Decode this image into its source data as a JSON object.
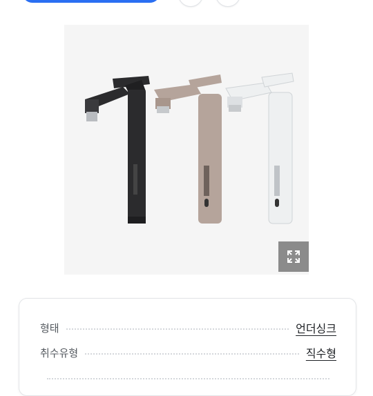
{
  "product": {
    "image_alt": "",
    "colors": [
      "#2b2b2d",
      "#b5a49b",
      "#eef0f1"
    ]
  },
  "zoom": {
    "icon": "expand-icon"
  },
  "specs": [
    {
      "label": "형태",
      "value": "언더싱크"
    },
    {
      "label": "취수유형",
      "value": "직수형"
    },
    {
      "label": "",
      "value": ""
    }
  ]
}
